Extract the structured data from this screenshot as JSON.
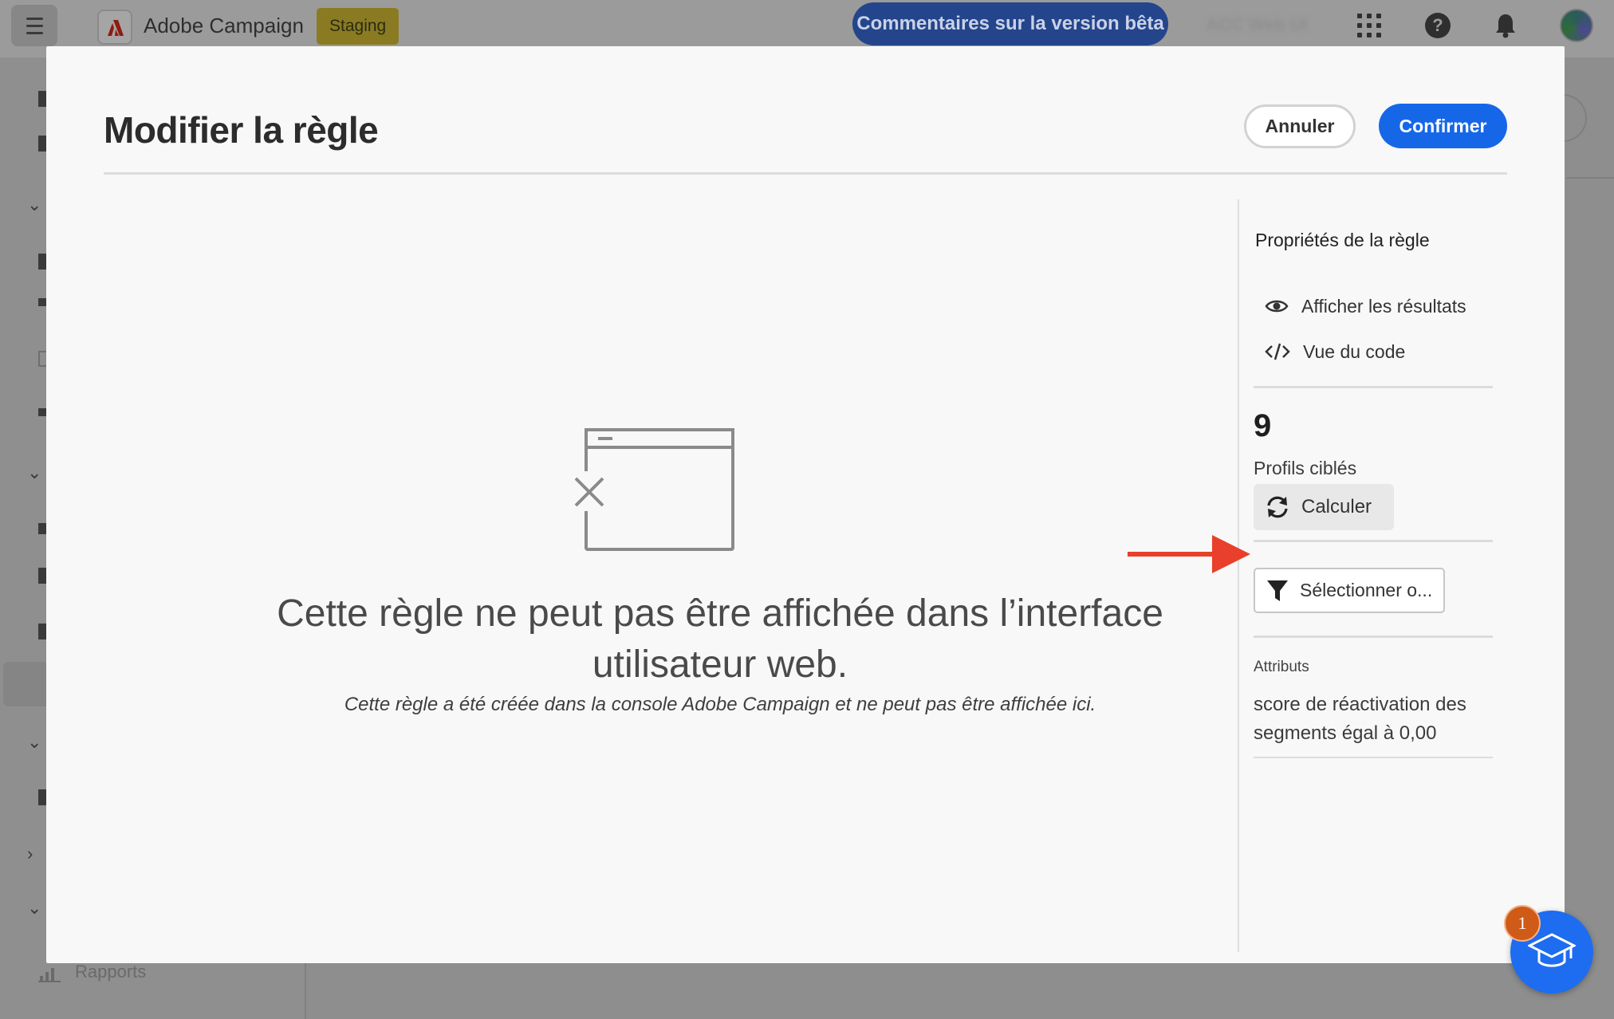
{
  "header": {
    "app_name": "Adobe Campaign",
    "environment_badge": "Staging",
    "beta_feedback_label": "Commentaires sur la version bêta",
    "org_name": "ACC Web UI",
    "icons": [
      "menu-icon",
      "adobe-logo",
      "apps-grid-icon",
      "help-icon",
      "bell-icon",
      "avatar"
    ]
  },
  "sidebar": {
    "reports_label": "Rapports"
  },
  "modal": {
    "title": "Modifier la règle",
    "cancel_label": "Annuler",
    "confirm_label": "Confirmer",
    "empty_state": {
      "title": "Cette règle ne peut pas être affichée dans l’interface utilisateur web.",
      "description": "Cette règle a été créée dans la console Adobe Campaign et ne peut pas être affichée ici."
    },
    "panel": {
      "heading": "Propriétés de la règle",
      "show_results_label": "Afficher les résultats",
      "code_view_label": "Vue du code",
      "profile_count": "9",
      "profile_count_label": "Profils ciblés",
      "calculate_label": "Calculer",
      "select_label": "Sélectionner o...",
      "attributes_title": "Attributs",
      "attributes_value": "score de réactivation des segments égal à 0,00"
    }
  },
  "help_fab": {
    "badge_count": "1"
  },
  "colors": {
    "primary": "#1667e8",
    "annotation_arrow": "#e8402a",
    "badge": "#d05a17",
    "environment_badge": "#8a7b22"
  }
}
